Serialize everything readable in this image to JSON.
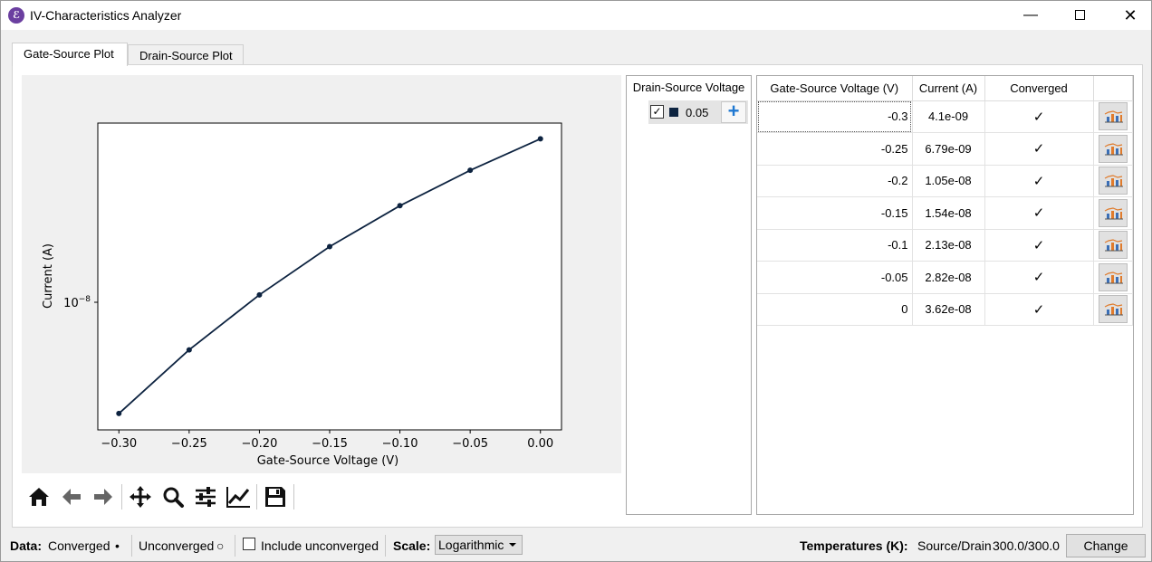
{
  "window": {
    "title": "IV-Characteristics Analyzer",
    "icon": "app-logo-icon",
    "controls": [
      "minimize",
      "maximize",
      "close"
    ]
  },
  "tabs": [
    {
      "label": "Gate-Source Plot",
      "active": true
    },
    {
      "label": "Drain-Source Plot",
      "active": false
    }
  ],
  "chart_data": {
    "type": "line",
    "x": [
      -0.3,
      -0.25,
      -0.2,
      -0.15,
      -0.1,
      -0.05,
      0
    ],
    "series": [
      {
        "values": [
          4.1e-09,
          6.79e-09,
          1.05e-08,
          1.54e-08,
          2.13e-08,
          2.82e-08,
          3.62e-08
        ],
        "color": "#0d2340"
      }
    ],
    "xlabel": "Gate-Source Voltage (V)",
    "ylabel": "Current (A)",
    "xtick_labels": [
      "−0.30",
      "−0.25",
      "−0.20",
      "−0.15",
      "−0.10",
      "−0.05",
      "0.00"
    ],
    "ytick_base": "10",
    "ytick_exp": "−8",
    "yscale": "log",
    "xlim": [
      -0.315,
      0.015
    ],
    "ylim": [
      3.6e-09,
      4.1e-08
    ],
    "grid": false
  },
  "plot_toolbar": [
    "home-icon",
    "back-arrow-icon",
    "forward-arrow-icon",
    "pan-icon",
    "zoom-icon",
    "configure-subplots-icon",
    "edit-axis-icon",
    "save-icon"
  ],
  "drain_source": {
    "header": "Drain-Source Voltage",
    "items": [
      {
        "checked": true,
        "value": "0.05",
        "color": "#0d2340"
      }
    ],
    "add_label": "+"
  },
  "table": {
    "headers": [
      "Gate-Source Voltage (V)",
      "Current (A)",
      "Converged"
    ],
    "rows": [
      {
        "voltage": "-0.3",
        "current": "4.1e-09",
        "converged": "✓"
      },
      {
        "voltage": "-0.25",
        "current": "6.79e-09",
        "converged": "✓"
      },
      {
        "voltage": "-0.2",
        "current": "1.05e-08",
        "converged": "✓"
      },
      {
        "voltage": "-0.15",
        "current": "1.54e-08",
        "converged": "✓"
      },
      {
        "voltage": "-0.1",
        "current": "2.13e-08",
        "converged": "✓"
      },
      {
        "voltage": "-0.05",
        "current": "2.82e-08",
        "converged": "✓"
      },
      {
        "voltage": "0",
        "current": "3.62e-08",
        "converged": "✓"
      }
    ]
  },
  "status": {
    "data_label": "Data:",
    "converged_label": "Converged",
    "converged_marker": "•",
    "unconverged_label": "Unconverged",
    "unconverged_marker": "○",
    "include_unconverged_label": "Include unconverged",
    "include_unconverged_checked": false,
    "scale_label": "Scale:",
    "scale_value": "Logarithmic",
    "temperatures_label": "Temperatures (K):",
    "temperatures_text": "Source/Drain",
    "temperatures_value": "300.0/300.0",
    "change_label": "Change"
  }
}
